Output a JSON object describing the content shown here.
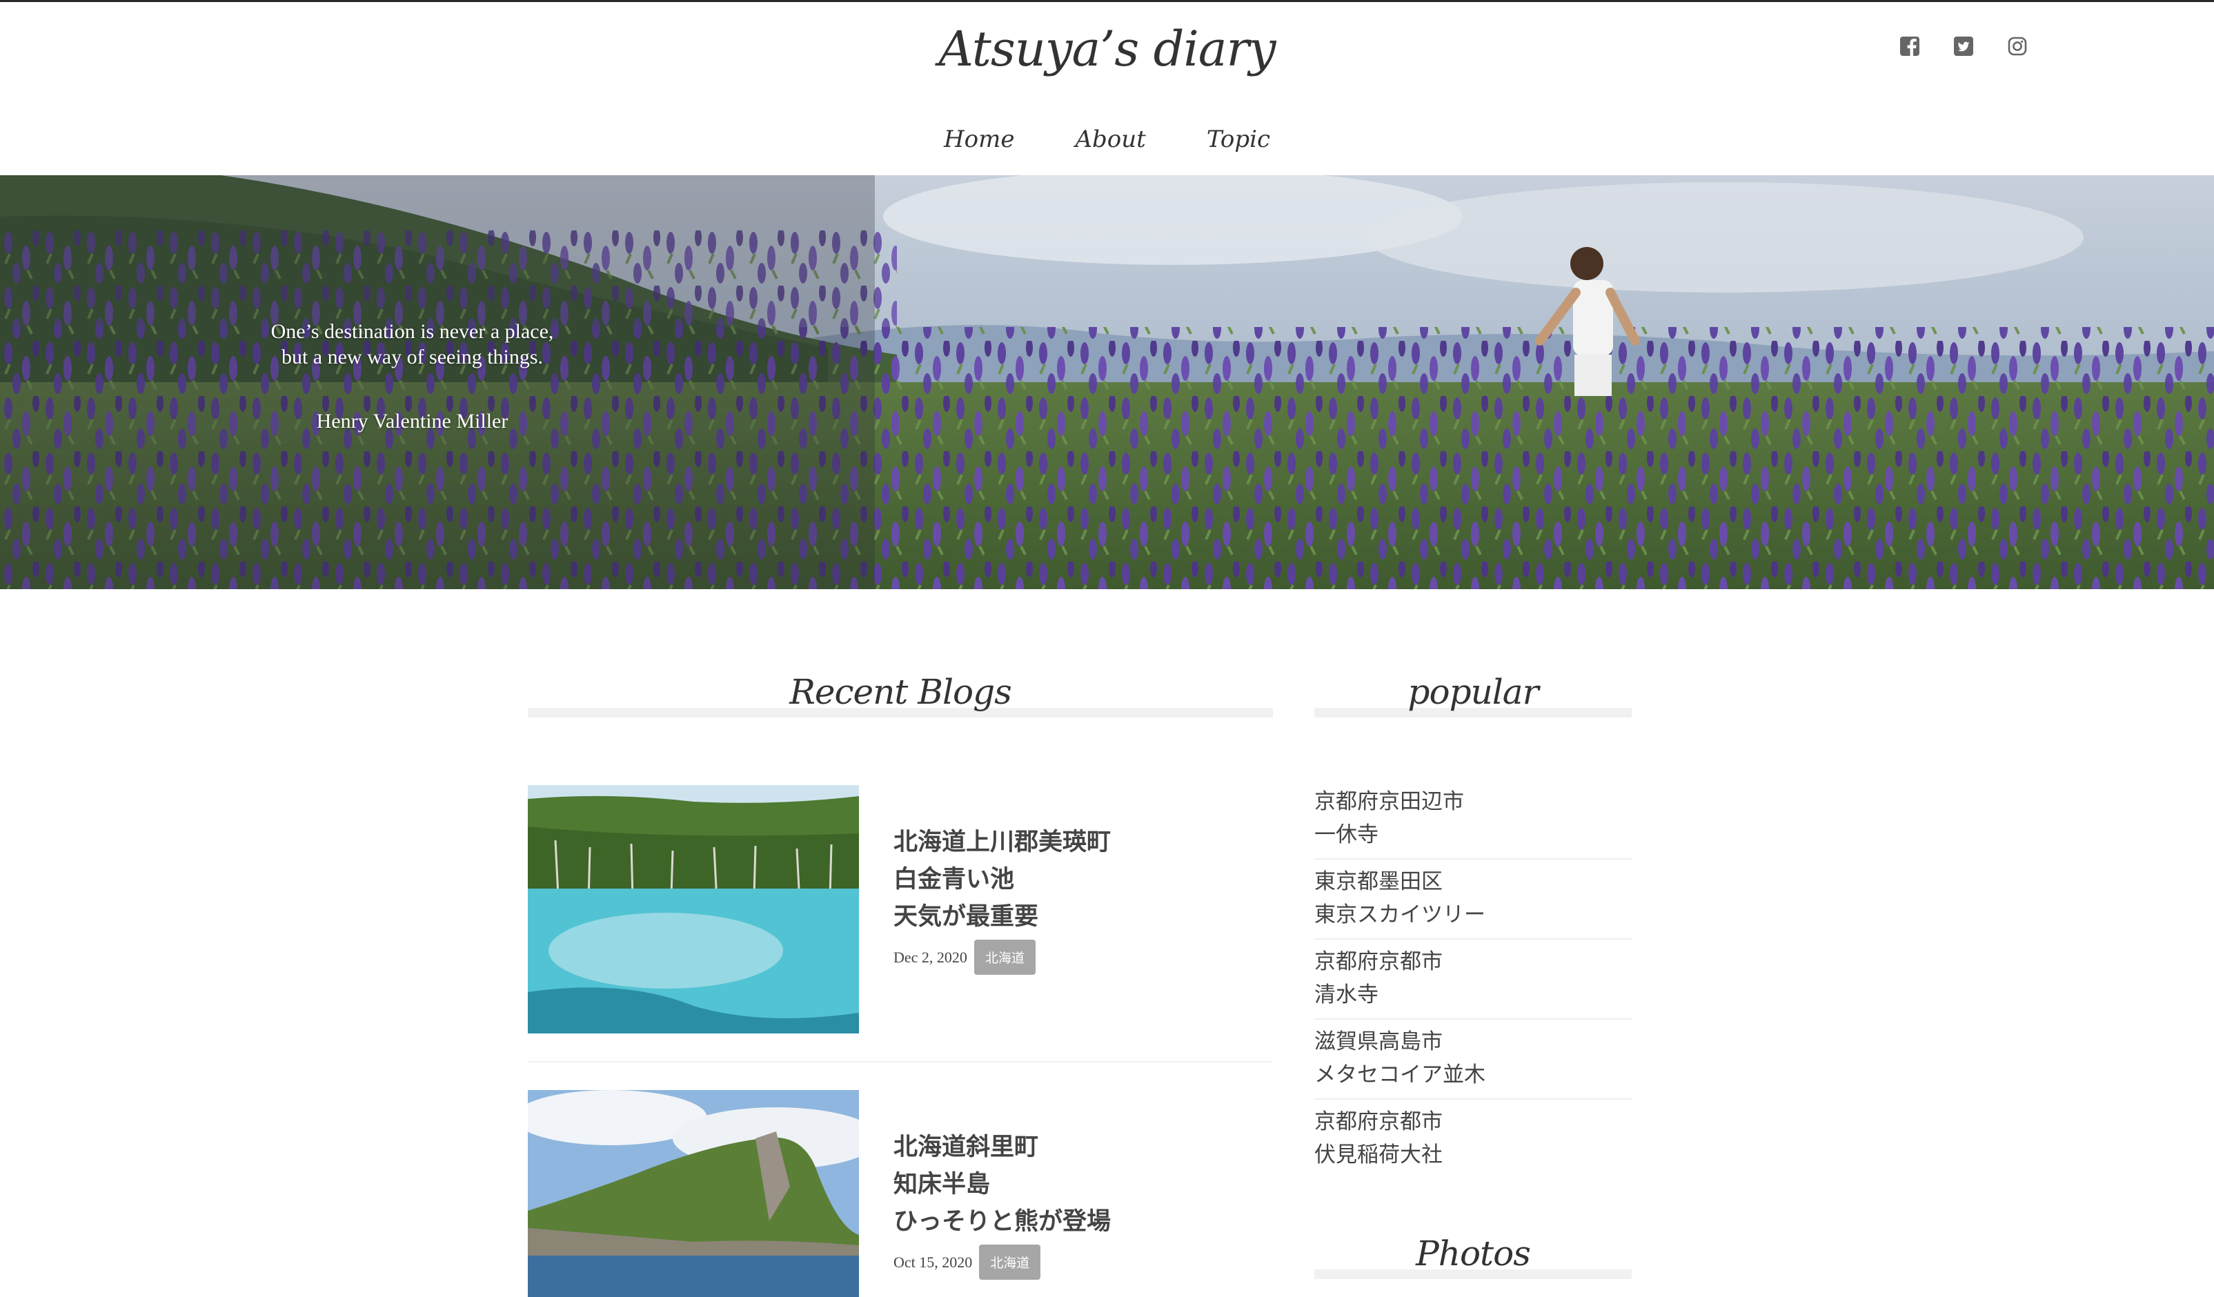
{
  "header": {
    "site_title": "Atsuya’s diary",
    "social_icons": [
      "facebook-icon",
      "twitter-icon",
      "instagram-icon"
    ]
  },
  "nav": {
    "items": [
      {
        "label": "Home"
      },
      {
        "label": "About"
      },
      {
        "label": "Topic"
      }
    ]
  },
  "hero": {
    "quote_lines": [
      "One’s destination is never a place,",
      "but a new way of seeing things."
    ],
    "author": "Henry Valentine Miller"
  },
  "recent_blogs": {
    "heading": "Recent Blogs",
    "posts": [
      {
        "title_lines": [
          "北海道上川郡美瑛町",
          "白金青い池",
          "天気が最重要"
        ],
        "date": "Dec 2, 2020",
        "tag": "北海道"
      },
      {
        "title_lines": [
          "北海道斜里町",
          "知床半島",
          "ひっそりと熊が登場"
        ],
        "date": "Oct 15, 2020",
        "tag": "北海道"
      }
    ]
  },
  "popular": {
    "heading": "popular",
    "items": [
      {
        "line1": "京都府京田辺市",
        "line2": "一休寺"
      },
      {
        "line1": "東京都墨田区",
        "line2": "東京スカイツリー"
      },
      {
        "line1": "京都府京都市",
        "line2": "清水寺"
      },
      {
        "line1": "滋賀県高島市",
        "line2": "メタセコイア並木"
      },
      {
        "line1": "京都府京都市",
        "line2": "伏見稲荷大社"
      }
    ]
  },
  "photos": {
    "heading": "Photos"
  },
  "colors": {
    "text": "#333333",
    "heading_bar": "#f1f1f1",
    "tag_bg": "#a6a6a6",
    "lavender": "#5a3f9e"
  }
}
